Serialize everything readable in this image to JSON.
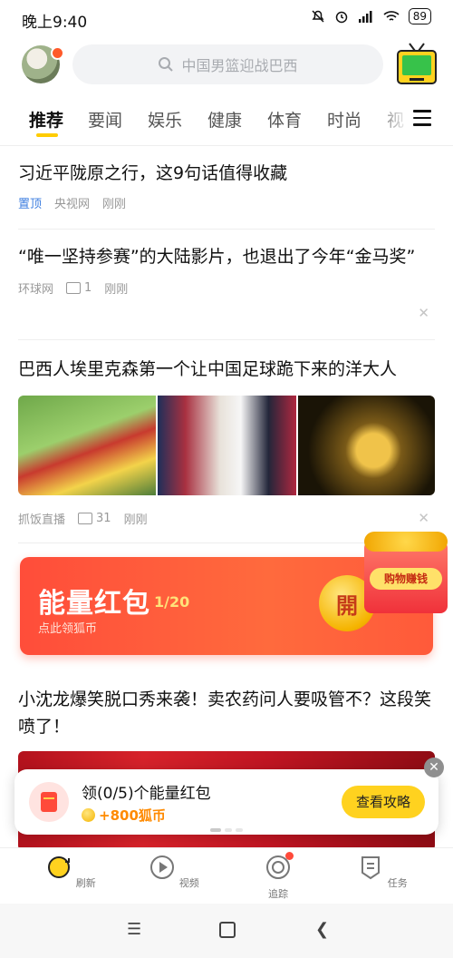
{
  "status_bar": {
    "time": "晚上9:40",
    "battery": "89"
  },
  "header": {
    "search_placeholder": "中国男篮迎战巴西"
  },
  "tabs": [
    {
      "label": "推荐"
    },
    {
      "label": "要闻"
    },
    {
      "label": "娱乐"
    },
    {
      "label": "健康"
    },
    {
      "label": "体育"
    },
    {
      "label": "时尚"
    },
    {
      "label": "视"
    }
  ],
  "articles": [
    {
      "title": "习近平陇原之行，这9句话值得收藏",
      "tag": "置顶",
      "source": "央视网",
      "time": "刚刚"
    },
    {
      "title": "“唯一坚持参赛”的大陆影片，也退出了今年“金马奖”",
      "source": "环球网",
      "comments": "1",
      "time": "刚刚"
    },
    {
      "title": "巴西人埃里克森第一个让中国足球跪下来的洋大人",
      "source": "抓饭直播",
      "comments": "31",
      "time": "刚刚"
    },
    {
      "title": "小沈龙爆笑脱口秀来袭！卖农药问人要吸管不？这段笑喷了！"
    }
  ],
  "energy_banner": {
    "title": "能量红包",
    "count": "1/20",
    "subtitle": "点此领狐币",
    "coin_label": "開",
    "gift_label": "购物赚钱"
  },
  "task_card": {
    "title": "领(0/5)个能量红包",
    "reward": "+800狐币",
    "button": "查看攻略"
  },
  "bottom_nav": [
    {
      "label": "刷新",
      "icon": "refresh-icon"
    },
    {
      "label": "视频",
      "icon": "play-icon"
    },
    {
      "label": "追踪",
      "icon": "target-icon"
    },
    {
      "label": "任务",
      "icon": "task-icon"
    }
  ],
  "colors": {
    "accent": "#ffcc00",
    "pin_blue": "#3f7fe0",
    "banner_red": "#ff4d3a",
    "reward_orange": "#ff8a00"
  }
}
